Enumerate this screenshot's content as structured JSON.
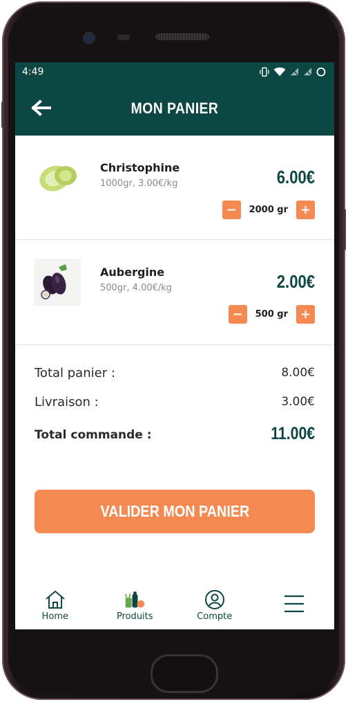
{
  "statusbar": {
    "time": "4:49"
  },
  "appbar": {
    "title": "MON PANIER"
  },
  "items": [
    {
      "name": "Christophine",
      "detail": "1000gr, 3.00€/kg",
      "price": "6.00€",
      "quantity": "2000 gr",
      "thumb": "chayote-image"
    },
    {
      "name": "Aubergine",
      "detail": "500gr, 4.00€/kg",
      "price": "2.00€",
      "quantity": "500 gr",
      "thumb": "eggplant-image"
    }
  ],
  "qty_controls": {
    "minus": "−",
    "plus": "+"
  },
  "totals": {
    "cart_label": "Total panier :",
    "cart_value": "8.00€",
    "delivery_label": "Livraison :",
    "delivery_value": "3.00€",
    "order_label": "Total commande :",
    "order_value": "11.00€"
  },
  "validate_label": "VALIDER MON PANIER",
  "nav": {
    "home": "Home",
    "products": "Produits",
    "account": "Compte"
  },
  "colors": {
    "primary": "#0d4743",
    "accent": "#f48a52"
  }
}
